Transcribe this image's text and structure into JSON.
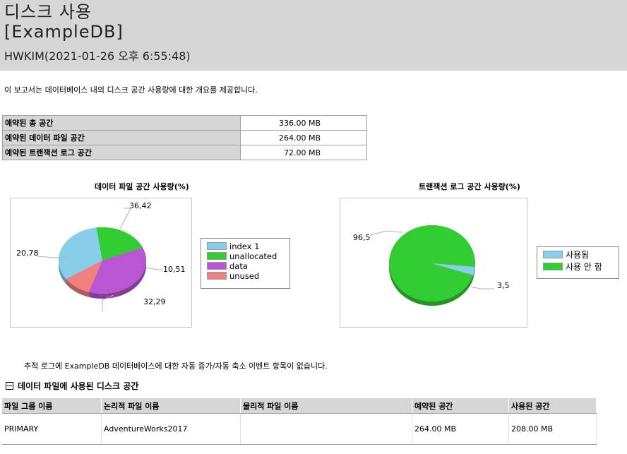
{
  "header": {
    "title": "디스크 사용",
    "database": "[ExampleDB]",
    "subtitle": "HWKIM(2021-01-26 오후 6:55:48)"
  },
  "description": "이 보고서는 데이터베이스 내의 디스크 공간 사용량에 대한 개요를 제공합니다.",
  "summary": [
    {
      "label": "예약된 총 공간",
      "value": "336.00 MB"
    },
    {
      "label": "예약된 데이터 파일 공간",
      "value": "264.00 MB"
    },
    {
      "label": "예약된 트랜잭션 로그 공간",
      "value": "72.00 MB"
    }
  ],
  "chart_data": [
    {
      "type": "pie",
      "title": "데이터 파일 공간 사용량(%)",
      "labels": [
        "index 1",
        "unallocated",
        "data",
        "unused"
      ],
      "values": [
        32.29,
        20.78,
        36.42,
        10.51
      ],
      "value_labels": [
        "32,29",
        "20,78",
        "36,42",
        "10,51"
      ],
      "colors": [
        "#87ceeb",
        "#32cd32",
        "#ba55d3",
        "#f08080"
      ]
    },
    {
      "type": "pie",
      "title": "트랜잭션 로그 공간 사용량(%)",
      "labels": [
        "사용됨",
        "사용 안 함"
      ],
      "values": [
        3.5,
        96.5
      ],
      "value_labels": [
        "3,5",
        "96,5"
      ],
      "colors": [
        "#87ceeb",
        "#32cd32"
      ]
    }
  ],
  "autogrow_note": "추적 로그에 ExampleDB 데이터베이스에 대한 자동 증가/자동 축소 이벤트 항목이 없습니다.",
  "files_section": {
    "title": "데이터 파일에 사용된 디스크 공간",
    "columns": [
      "파일 그룹 이름",
      "논리적 파일 이름",
      "물리적 파일 이름",
      "예약된 공간",
      "사용된 공간"
    ],
    "rows": [
      [
        "PRIMARY",
        "AdventureWorks2017",
        "",
        "264.00 MB",
        "208.00 MB"
      ]
    ]
  }
}
